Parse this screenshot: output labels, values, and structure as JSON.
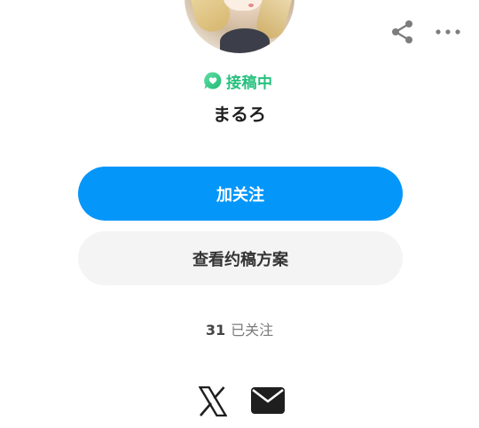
{
  "profile": {
    "status_label": "接稿中",
    "username": "まるろ"
  },
  "actions": {
    "follow_label": "加关注",
    "view_plans_label": "查看约稿方案"
  },
  "stats": {
    "following_count": "31",
    "following_label": "已关注"
  },
  "icons": {
    "share": "share-icon",
    "more": "more-horizontal-icon",
    "status": "speech-bubble-heart-icon",
    "x": "x-logo-icon",
    "mail": "mail-icon"
  },
  "colors": {
    "accent": "#0596fa",
    "status_green": "#27c07e",
    "secondary_button": "#f4f4f4"
  }
}
